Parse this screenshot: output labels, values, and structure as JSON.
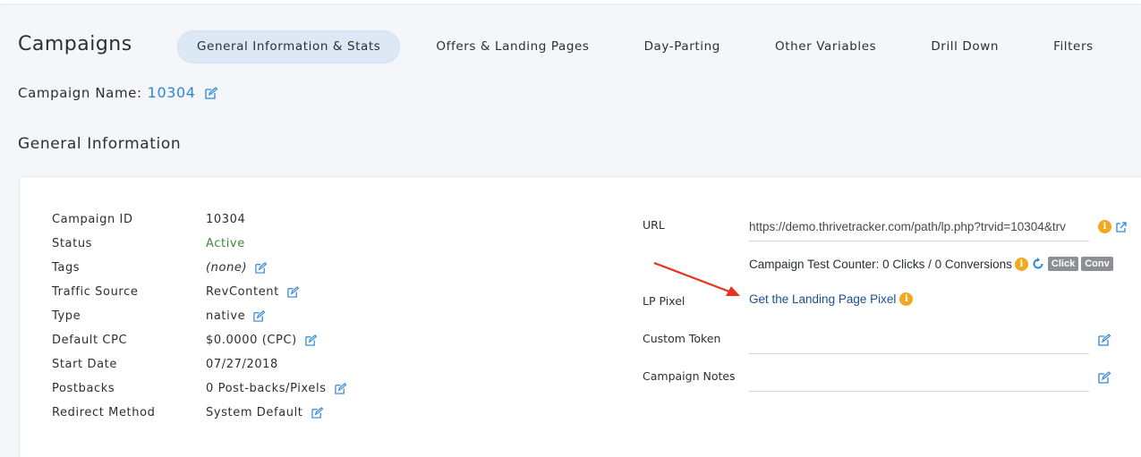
{
  "header": {
    "title": "Campaigns",
    "tabs": [
      {
        "label": "General Information & Stats",
        "active": true
      },
      {
        "label": "Offers & Landing Pages"
      },
      {
        "label": "Day-Parting"
      },
      {
        "label": "Other Variables"
      },
      {
        "label": "Drill Down"
      },
      {
        "label": "Filters"
      }
    ]
  },
  "campaign": {
    "name_label": "Campaign Name:",
    "name_value": "10304"
  },
  "section": {
    "title": "General Information"
  },
  "info": {
    "campaign_id": {
      "label": "Campaign ID",
      "value": "10304"
    },
    "status": {
      "label": "Status",
      "value": "Active"
    },
    "tags": {
      "label": "Tags",
      "value": "(none)"
    },
    "traffic_source": {
      "label": "Traffic Source",
      "value": "RevContent"
    },
    "type": {
      "label": "Type",
      "value": "native"
    },
    "default_cpc": {
      "label": "Default CPC",
      "value": "$0.0000 (CPC)"
    },
    "start_date": {
      "label": "Start Date",
      "value": "07/27/2018"
    },
    "postbacks": {
      "label": "Postbacks",
      "value": "0 Post-backs/Pixels"
    },
    "redirect_method": {
      "label": "Redirect Method",
      "value": "System Default"
    }
  },
  "right": {
    "url_label": "URL",
    "url_value": "https://demo.thrivetracker.com/path/lp.php?trvid=10304&trv",
    "counter_text": "Campaign Test Counter: 0 Clicks / 0 Conversions",
    "click_pill": "Click",
    "conv_pill": "Conv",
    "lp_pixel_label": "LP Pixel",
    "lp_pixel_link": "Get the Landing Page Pixel",
    "custom_token_label": "Custom Token",
    "campaign_notes_label": "Campaign Notes",
    "info_glyph": "i"
  },
  "colors": {
    "accent": "#2e86d9",
    "active_status": "#3a8a3a",
    "info_icon": "#f0a820",
    "annotation_arrow": "#e8311f"
  },
  "icons": [
    "edit-icon",
    "info-icon",
    "external-link-icon",
    "refresh-icon",
    "annotation-arrow"
  ]
}
